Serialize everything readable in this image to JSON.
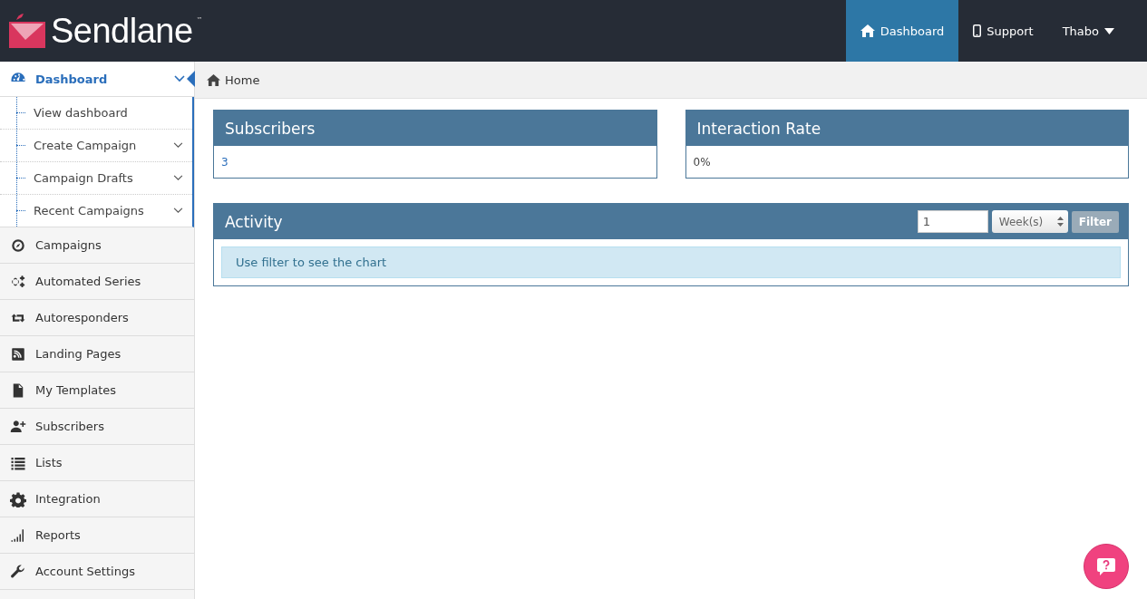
{
  "header": {
    "logo": {
      "name": "Sendlane",
      "mark": "™"
    },
    "nav": [
      {
        "label": "Dashboard",
        "kind": "home",
        "selected": true
      },
      {
        "label": "Support",
        "kind": "phone",
        "selected": false
      },
      {
        "label": "Thabo",
        "kind": "user",
        "selected": false
      }
    ]
  },
  "sidebar": {
    "items": [
      {
        "label": "Dashboard",
        "selected": true,
        "expanded": true,
        "children": [
          {
            "label": "View dashboard",
            "kind": "link"
          },
          {
            "label": "Create Campaign",
            "kind": "submenu"
          },
          {
            "label": "Campaign Drafts",
            "kind": "submenu"
          },
          {
            "label": "Recent Campaigns",
            "kind": "submenu"
          }
        ]
      },
      {
        "label": "Campaigns",
        "selected": false
      },
      {
        "label": "Automated Series",
        "selected": false
      },
      {
        "label": "Autoresponders",
        "selected": false
      },
      {
        "label": "Landing Pages",
        "selected": false
      },
      {
        "label": "My Templates",
        "selected": false
      },
      {
        "label": "Subscribers",
        "selected": false
      },
      {
        "label": "Lists",
        "selected": false
      },
      {
        "label": "Integration",
        "selected": false
      },
      {
        "label": "Reports",
        "selected": false
      },
      {
        "label": "Account Settings",
        "selected": false
      }
    ]
  },
  "breadcrumb": "Home",
  "stats": [
    {
      "title": "Subscribers",
      "value": "3",
      "kind": "link"
    },
    {
      "title": "Interaction Rate",
      "value": "0%",
      "kind": "plain"
    }
  ],
  "activity": {
    "title": "Activity",
    "amount": "1",
    "unit": "Week(s)",
    "button": "Filter",
    "message": "Use filter to see the chart"
  }
}
